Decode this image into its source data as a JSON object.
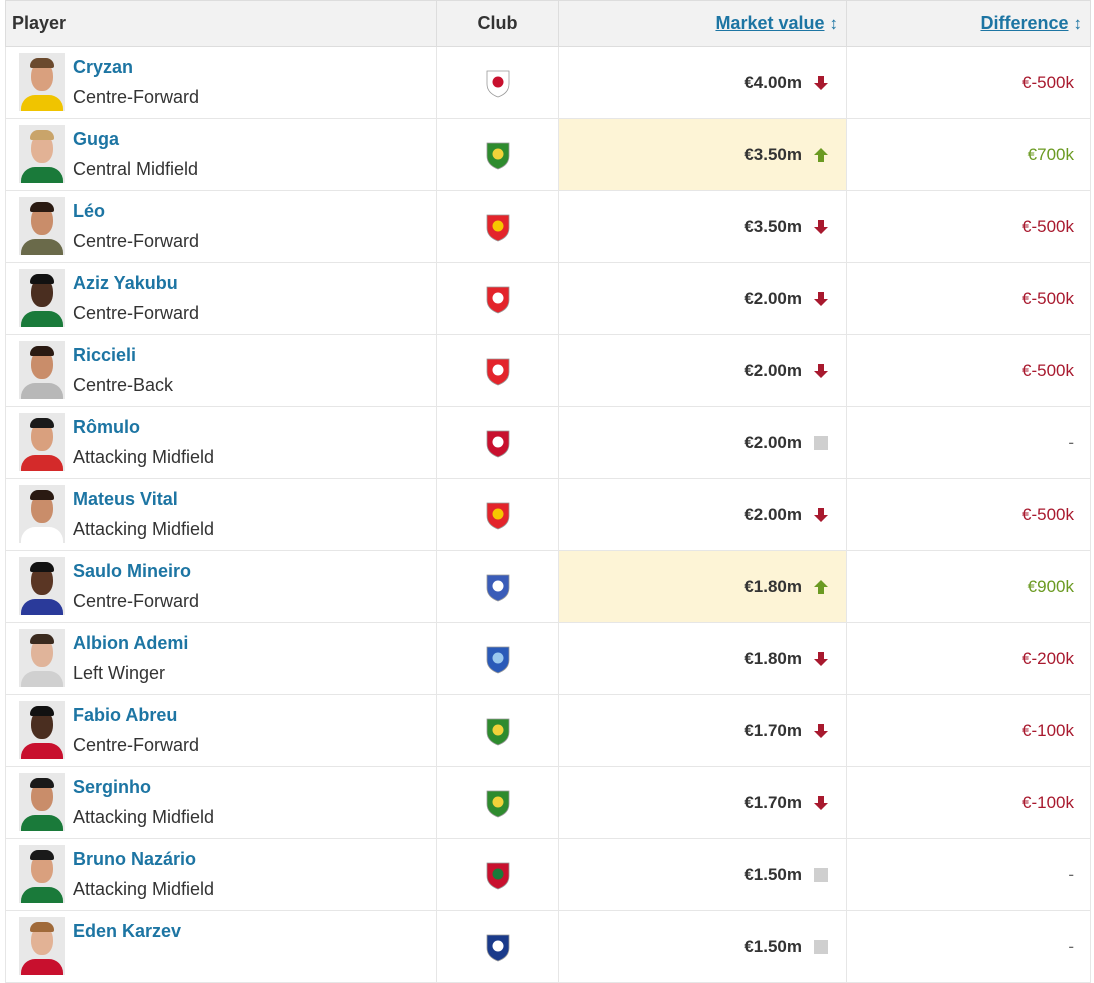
{
  "header": {
    "player": "Player",
    "club": "Club",
    "market_value": "Market value",
    "difference": "Difference",
    "sort_icon": "sort-arrows-icon"
  },
  "colors": {
    "link": "#1d75a3",
    "down": "#a8192e",
    "up": "#6b9a22",
    "unchanged": "#cfcfcf",
    "highlight": "#fdf4d6"
  },
  "rows": [
    {
      "name": "Cryzan",
      "position": "Centre-Forward",
      "club_icon": "changchun-crest-icon",
      "market_value": "€4.00m",
      "trend": "down",
      "difference": "€-500k",
      "skin": "#d9a07e",
      "hair": "#6b4a2e",
      "shirt": "#f0c400",
      "crest_a": "#ffffff",
      "crest_b": "#c8102e"
    },
    {
      "name": "Guga",
      "position": "Central Midfield",
      "club_icon": "zhejiang-crest-icon",
      "market_value": "€3.50m",
      "trend": "up",
      "difference": "€700k",
      "skin": "#e2b295",
      "hair": "#c9a46a",
      "shirt": "#1a7a3a",
      "crest_a": "#2e8b2e",
      "crest_b": "#f2d23a"
    },
    {
      "name": "Léo",
      "position": "Centre-Forward",
      "club_icon": "shanghai-port-crest-icon",
      "market_value": "€3.50m",
      "trend": "down",
      "difference": "€-500k",
      "skin": "#c98d6a",
      "hair": "#2a1a12",
      "shirt": "#6a6a4a",
      "crest_a": "#e3242b",
      "crest_b": "#f6c700"
    },
    {
      "name": "Aziz Yakubu",
      "position": "Centre-Forward",
      "club_icon": "changchun-yatai-crest-icon",
      "market_value": "€2.00m",
      "trend": "down",
      "difference": "€-500k",
      "skin": "#4a2e20",
      "hair": "#111111",
      "shirt": "#1a7a3a",
      "crest_a": "#e3242b",
      "crest_b": "#ffffff"
    },
    {
      "name": "Riccieli",
      "position": "Centre-Back",
      "club_icon": "changchun-yatai-crest-icon",
      "market_value": "€2.00m",
      "trend": "down",
      "difference": "€-500k",
      "skin": "#c98d6a",
      "hair": "#2a1a12",
      "shirt": "#b8b8b8",
      "crest_a": "#e3242b",
      "crest_b": "#ffffff"
    },
    {
      "name": "Rômulo",
      "position": "Attacking Midfield",
      "club_icon": "chengdu-crest-icon",
      "market_value": "€2.00m",
      "trend": "none",
      "difference": "-",
      "skin": "#d9a07e",
      "hair": "#1a1a1a",
      "shirt": "#d42a2a",
      "crest_a": "#c8102e",
      "crest_b": "#ffffff"
    },
    {
      "name": "Mateus Vital",
      "position": "Attacking Midfield",
      "club_icon": "shanghai-port-crest-icon",
      "market_value": "€2.00m",
      "trend": "down",
      "difference": "€-500k",
      "skin": "#c98d6a",
      "hair": "#2a1a12",
      "shirt": "#ffffff",
      "crest_a": "#e3242b",
      "crest_b": "#f6c700"
    },
    {
      "name": "Saulo Mineiro",
      "position": "Centre-Forward",
      "club_icon": "shanghai-shenhua-crest-icon",
      "market_value": "€1.80m",
      "trend": "up",
      "difference": "€900k",
      "skin": "#5a3624",
      "hair": "#111111",
      "shirt": "#2a3a9a",
      "crest_a": "#3a5cb8",
      "crest_b": "#ffffff"
    },
    {
      "name": "Albion Ademi",
      "position": "Left Winger",
      "club_icon": "qingdao-crest-icon",
      "market_value": "€1.80m",
      "trend": "down",
      "difference": "€-200k",
      "skin": "#e0b49a",
      "hair": "#3a2a1e",
      "shirt": "#d0d0d0",
      "crest_a": "#2a5ab8",
      "crest_b": "#9ac8ee"
    },
    {
      "name": "Fabio Abreu",
      "position": "Centre-Forward",
      "club_icon": "zhejiang-crest-icon",
      "market_value": "€1.70m",
      "trend": "down",
      "difference": "€-100k",
      "skin": "#4a2e20",
      "hair": "#111111",
      "shirt": "#c8102e",
      "crest_a": "#2e8b2e",
      "crest_b": "#f2d23a"
    },
    {
      "name": "Serginho",
      "position": "Attacking Midfield",
      "club_icon": "zhejiang-crest-icon",
      "market_value": "€1.70m",
      "trend": "down",
      "difference": "€-100k",
      "skin": "#c98d6a",
      "hair": "#1a1a1a",
      "shirt": "#1a7a3a",
      "crest_a": "#2e8b2e",
      "crest_b": "#f2d23a"
    },
    {
      "name": "Bruno Nazário",
      "position": "Attacking Midfield",
      "club_icon": "henan-crest-icon",
      "market_value": "€1.50m",
      "trend": "none",
      "difference": "-",
      "skin": "#d9a07e",
      "hair": "#1a1a1a",
      "shirt": "#1a7a3a",
      "crest_a": "#c8102e",
      "crest_b": "#1a7a3a"
    },
    {
      "name": "Eden Karzev",
      "position": "",
      "club_icon": "dalian-crest-icon",
      "market_value": "€1.50m",
      "trend": "none",
      "difference": "-",
      "skin": "#e2b295",
      "hair": "#a06a3a",
      "shirt": "#c8102e",
      "crest_a": "#1a3a8a",
      "crest_b": "#ffffff"
    }
  ]
}
